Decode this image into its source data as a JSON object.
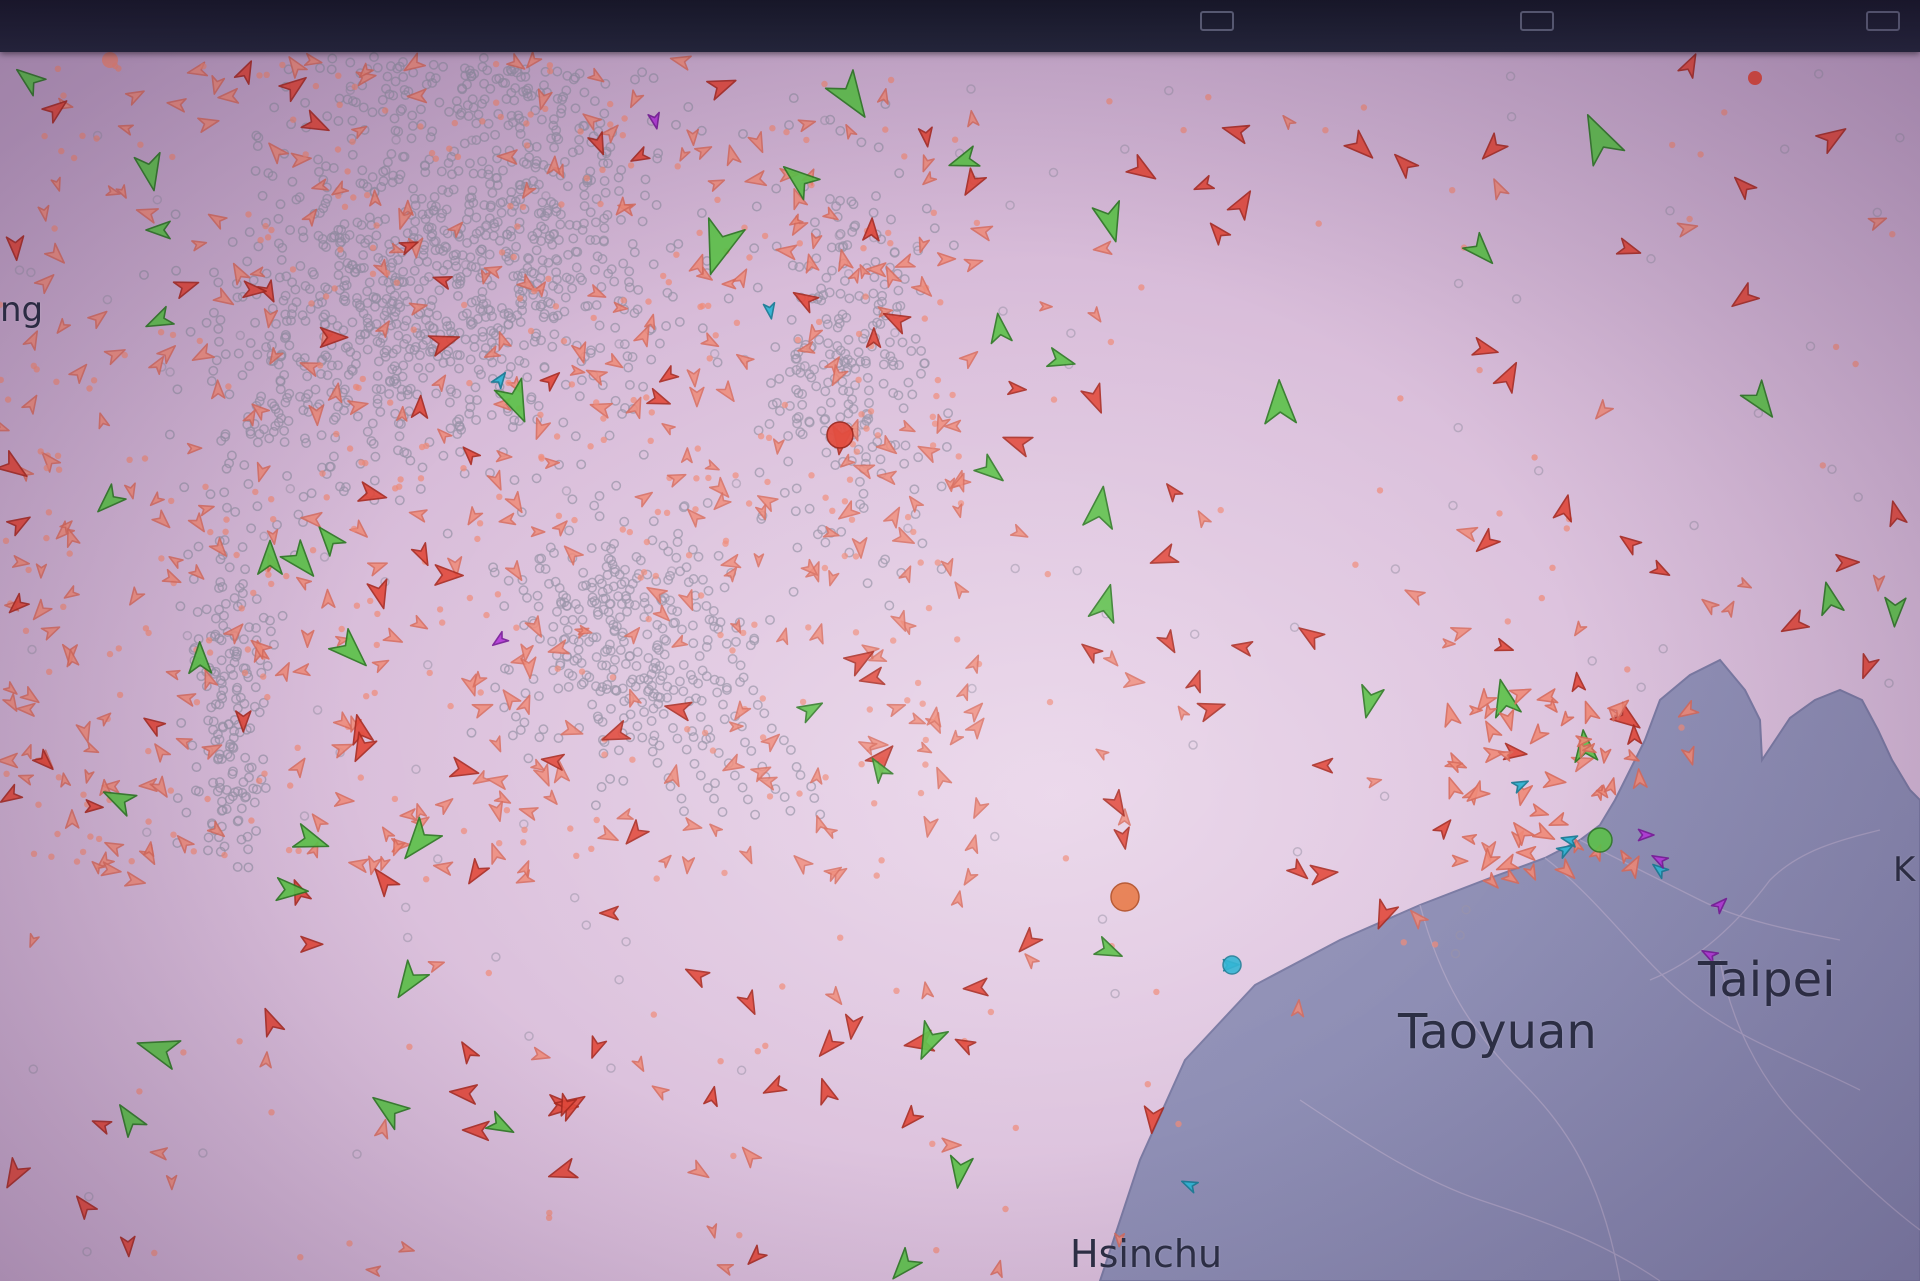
{
  "toolbar": {
    "item1_label": "",
    "item2_label": "",
    "item3_label": ""
  },
  "places": {
    "taipei": "Taipei",
    "taoyuan": "Taoyuan",
    "hsinchu": "Hsinchu",
    "edge_left": "ng",
    "edge_right": "K"
  },
  "legend_colors": {
    "cargo": "#5dc24a",
    "tanker": "#e2483a",
    "fishing": "#f08a78",
    "passenger": "#2fb4d4",
    "pleasure": "#b33ad8",
    "anchored_unknown": "#9a94a8",
    "highlight": "#e87a4a",
    "water": "#d8bfd8",
    "land": "#8f8fb6"
  }
}
